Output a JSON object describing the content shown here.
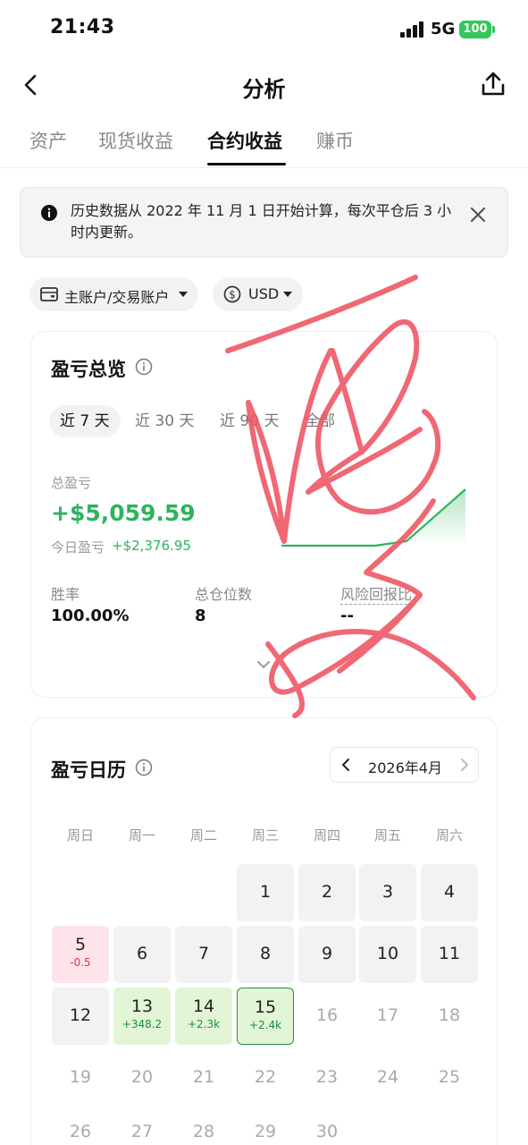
{
  "status_bar": {
    "time": "21:43",
    "network": "5G",
    "battery": "100"
  },
  "nav": {
    "title": "分析"
  },
  "tabs": [
    {
      "label": "资产",
      "active": false
    },
    {
      "label": "现货收益",
      "active": false
    },
    {
      "label": "合约收益",
      "active": true
    },
    {
      "label": "赚币",
      "active": false
    }
  ],
  "notice": {
    "text": "历史数据从 2022 年 11 月 1 日开始计算，每次平仓后 3 小时内更新。"
  },
  "filters": {
    "account": "主账户/交易账户",
    "currency": "USD"
  },
  "overview": {
    "title": "盈亏总览",
    "periods": [
      "近 7 天",
      "近 30 天",
      "近 90 天",
      "全部"
    ],
    "active_period": "近 7 天",
    "total_label": "总盈亏",
    "total_value": "+$5,059.59",
    "today_label": "今日盈亏",
    "today_value": "+$2,376.95",
    "stats": [
      {
        "label": "胜率",
        "value": "100.00%"
      },
      {
        "label": "总仓位数",
        "value": "8"
      },
      {
        "label": "风险回报比",
        "value": "--"
      }
    ],
    "trend_color": "#2db35d"
  },
  "calendar": {
    "title": "盈亏日历",
    "month": "2026年4月",
    "weekdays": [
      "周日",
      "周一",
      "周二",
      "周三",
      "周四",
      "周五",
      "周六"
    ],
    "days": [
      {
        "day": "1",
        "pnl": ""
      },
      {
        "day": "2",
        "pnl": ""
      },
      {
        "day": "3",
        "pnl": ""
      },
      {
        "day": "4",
        "pnl": ""
      },
      {
        "day": "5",
        "pnl": "-0.5"
      },
      {
        "day": "6",
        "pnl": ""
      },
      {
        "day": "7",
        "pnl": ""
      },
      {
        "day": "8",
        "pnl": ""
      },
      {
        "day": "9",
        "pnl": ""
      },
      {
        "day": "10",
        "pnl": ""
      },
      {
        "day": "11",
        "pnl": ""
      },
      {
        "day": "12",
        "pnl": ""
      },
      {
        "day": "13",
        "pnl": "+348.2"
      },
      {
        "day": "14",
        "pnl": "+2.3k"
      },
      {
        "day": "15",
        "pnl": "+2.4k"
      },
      {
        "day": "16",
        "pnl": ""
      },
      {
        "day": "17",
        "pnl": ""
      },
      {
        "day": "18",
        "pnl": ""
      },
      {
        "day": "19",
        "pnl": ""
      },
      {
        "day": "20",
        "pnl": ""
      },
      {
        "day": "21",
        "pnl": ""
      },
      {
        "day": "22",
        "pnl": ""
      },
      {
        "day": "23",
        "pnl": ""
      },
      {
        "day": "24",
        "pnl": ""
      },
      {
        "day": "25",
        "pnl": ""
      },
      {
        "day": "26",
        "pnl": ""
      },
      {
        "day": "27",
        "pnl": ""
      },
      {
        "day": "28",
        "pnl": ""
      },
      {
        "day": "29",
        "pnl": ""
      },
      {
        "day": "30",
        "pnl": ""
      }
    ],
    "colors": {
      "profit": "#1f8b42",
      "loss": "#e0304d"
    }
  }
}
